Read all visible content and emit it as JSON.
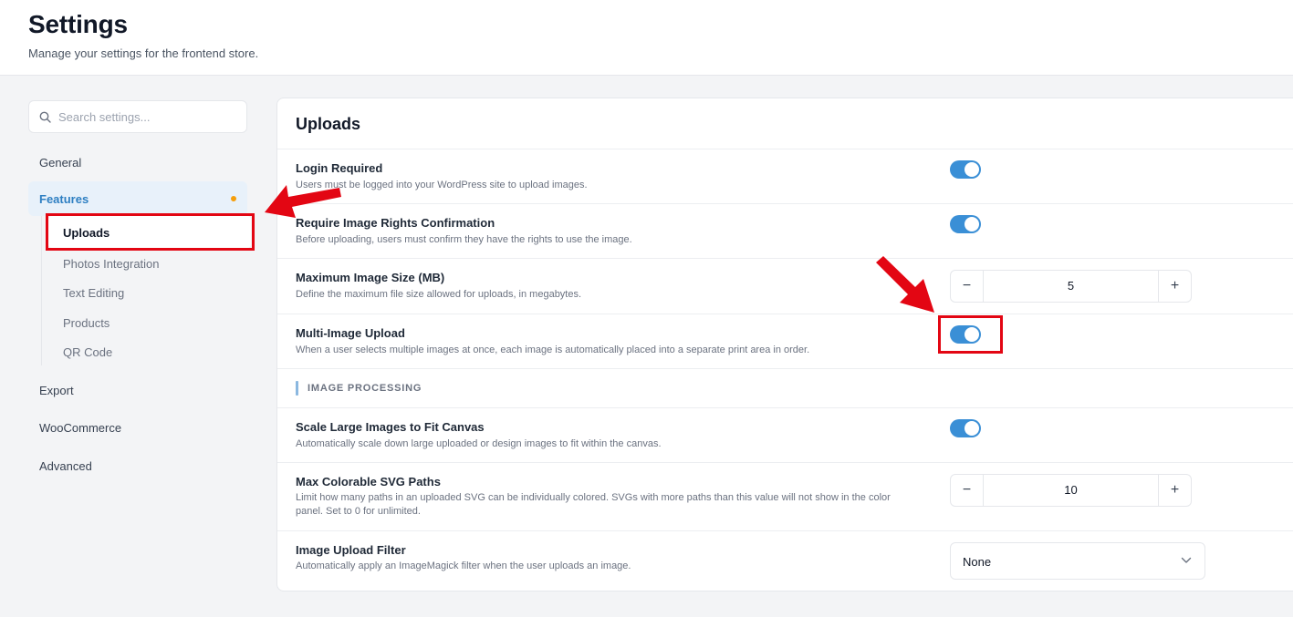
{
  "header": {
    "title": "Settings",
    "subtitle": "Manage your settings for the frontend store."
  },
  "search": {
    "placeholder": "Search settings..."
  },
  "sidebar": {
    "items": [
      {
        "label": "General"
      },
      {
        "label": "Features"
      },
      {
        "label": "Export"
      },
      {
        "label": "WooCommerce"
      },
      {
        "label": "Advanced"
      }
    ],
    "features_sub": [
      {
        "label": "Uploads"
      },
      {
        "label": "Photos Integration"
      },
      {
        "label": "Text Editing"
      },
      {
        "label": "Products"
      },
      {
        "label": "QR Code"
      }
    ]
  },
  "panel": {
    "title": "Uploads",
    "rows": [
      {
        "label": "Login Required",
        "desc": "Users must be logged into your WordPress site to upload images.",
        "enabled": true
      },
      {
        "label": "Require Image Rights Confirmation",
        "desc": "Before uploading, users must confirm they have the rights to use the image.",
        "enabled": true
      },
      {
        "label": "Maximum Image Size (MB)",
        "desc": "Define the maximum file size allowed for uploads, in megabytes.",
        "value": "5"
      },
      {
        "label": "Multi-Image Upload",
        "desc": "When a user selects multiple images at once, each image is automatically placed into a separate print area in order.",
        "enabled": true
      }
    ],
    "section_heading": "IMAGE PROCESSING",
    "processing_rows": [
      {
        "label": "Scale Large Images to Fit Canvas",
        "desc": "Automatically scale down large uploaded or design images to fit within the canvas.",
        "enabled": true
      },
      {
        "label": "Max Colorable SVG Paths",
        "desc_line1": "Limit how many paths in an uploaded SVG can be individually colored. SVGs with more paths than this value will not show in the color",
        "desc_line2": "panel. Set to 0 for unlimited.",
        "value": "10"
      },
      {
        "label": "Image Upload Filter",
        "desc": "Automatically apply an ImageMagick filter when the user uploads an image.",
        "selected": "None"
      }
    ],
    "stepper_minus": "−",
    "stepper_plus": "+"
  },
  "colors": {
    "accent": "#3a8fd6",
    "active_nav_text": "#2e7fc2",
    "annotation_red": "#e30613",
    "indicator_dot": "#f59e0b"
  }
}
